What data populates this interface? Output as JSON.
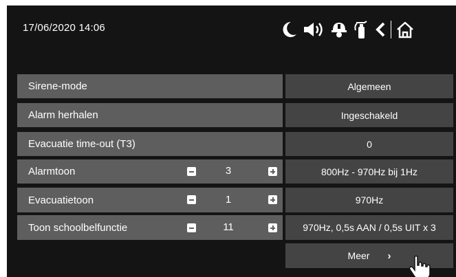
{
  "header": {
    "datetime": "17/06/2020  14:06",
    "icons": [
      "moon-icon",
      "speaker-icon",
      "firefighter-helmet-icon",
      "fire-extinguisher-icon",
      "back-icon",
      "home-icon"
    ]
  },
  "rows": [
    {
      "label": "Sirene-mode",
      "value": "Algemeen"
    },
    {
      "label": "Alarm herhalen",
      "value": "Ingeschakeld"
    },
    {
      "label": "Evacuatie time-out (T3)",
      "value": "0"
    },
    {
      "label": "Alarmtoon",
      "stepper": "3",
      "value": "800Hz - 970Hz bij 1Hz"
    },
    {
      "label": "Evacuatietoon",
      "stepper": "1",
      "value": "970Hz"
    },
    {
      "label": "Toon schoolbelfunctie",
      "stepper": "11",
      "value": "970Hz, 0,5s AAN / 0,5s UIT x 3"
    }
  ],
  "more": {
    "label": "Meer",
    "chevron": "›"
  },
  "colors": {
    "screen_bg": "#141414",
    "label_bg": "#5e5e5e",
    "value_bg": "#444444",
    "text": "#ffffff"
  }
}
